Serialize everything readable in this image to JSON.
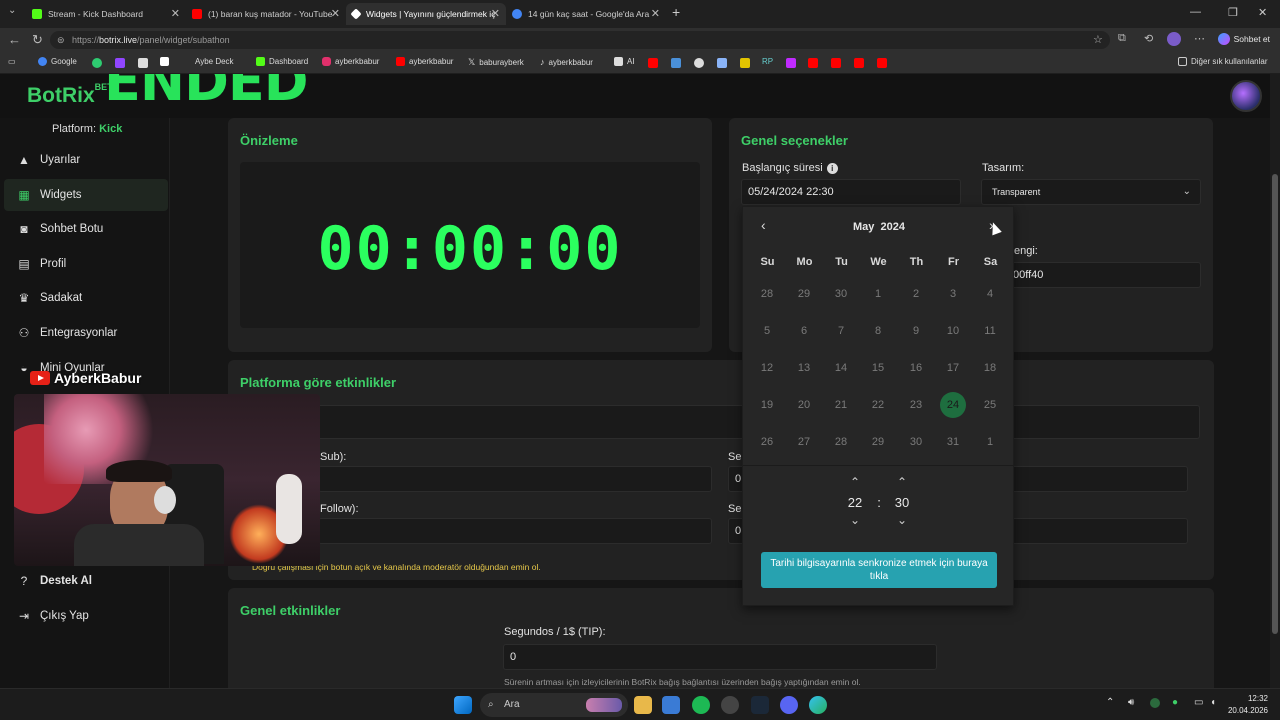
{
  "browser": {
    "tabs": [
      {
        "title": "Stream - Kick Dashboard",
        "color": "#53fc18"
      },
      {
        "title": "(1) baran kuş matador - YouTube",
        "color": "#ff0000"
      },
      {
        "title": "Widgets | Yayınını güçlendirmek iç",
        "color": "#ffffff"
      },
      {
        "title": "14 gün kaç saat - Google'da Ara",
        "color": "#4285f4"
      }
    ],
    "url_prefix": "https://",
    "url_host": "botrix.live",
    "url_path": "/panel/widget/subathon",
    "chat_button": "Sohbet et",
    "bookmarks": [
      "Google",
      "Aybe Deck",
      "Dashboard",
      "ayberkbabur",
      "ayberkbabur",
      "baburayberk",
      "ayberkbabur",
      "AI",
      "RP"
    ],
    "bookmarks_other": "Diğer sık kullanılanlar"
  },
  "app": {
    "logo": "BotRix",
    "logo_badge": "BETA",
    "overlay_text": "ENDED",
    "platform_label": "Platform:",
    "platform_value": "Kick",
    "nav": [
      {
        "label": "Uyarılar",
        "icon": "warning-icon"
      },
      {
        "label": "Widgets",
        "icon": "grid-icon"
      },
      {
        "label": "Sohbet Botu",
        "icon": "robot-icon"
      },
      {
        "label": "Profil",
        "icon": "id-card-icon"
      },
      {
        "label": "Sadakat",
        "icon": "trophy-icon"
      },
      {
        "label": "Entegrasyonlar",
        "icon": "plug-icon"
      },
      {
        "label": "Mini Oyunlar",
        "icon": "gamepad-icon"
      }
    ],
    "nav_bottom": [
      {
        "label": "Destek Al",
        "icon": "help-icon"
      },
      {
        "label": "Çıkış Yap",
        "icon": "logout-icon"
      }
    ]
  },
  "preview": {
    "title": "Önizleme",
    "timer": "00:00:00"
  },
  "general_options": {
    "title": "Genel seçenekler",
    "start_label": "Başlangıç süresi",
    "start_value": "05/24/2024 22:30",
    "design_label": "Tasarım:",
    "design_value": "Transparent",
    "color_label_fragment": "engi:",
    "color_value_fragment": "00ff40"
  },
  "calendar": {
    "month": "May",
    "year": "2024",
    "weekdays": [
      "Su",
      "Mo",
      "Tu",
      "We",
      "Th",
      "Fr",
      "Sa"
    ],
    "weeks": [
      [
        "28",
        "29",
        "30",
        "1",
        "2",
        "3",
        "4"
      ],
      [
        "5",
        "6",
        "7",
        "8",
        "9",
        "10",
        "11"
      ],
      [
        "12",
        "13",
        "14",
        "15",
        "16",
        "17",
        "18"
      ],
      [
        "19",
        "20",
        "21",
        "22",
        "23",
        "24",
        "25"
      ],
      [
        "26",
        "27",
        "28",
        "29",
        "30",
        "31",
        "1"
      ]
    ],
    "selected_day": "24",
    "hour": "22",
    "minute": "30",
    "separator": ":",
    "sync_button": "Tarihi bilgisayarınla senkronize etmek için buraya tıkla"
  },
  "platform_events": {
    "title": "Platforma göre etkinlikler",
    "sub_label_fragment": "Sub):",
    "follow_label_fragment": "Follow):",
    "right_label_fragment_1": "Se",
    "right_label_fragment_2": "Se",
    "right_value_1": "0",
    "right_value_2": "0",
    "warning": "Doğru çalışması için botun açık ve kanalında moderatör olduğundan emin ol."
  },
  "general_events": {
    "title": "Genel etkinlikler",
    "tip_label": "Segundos / 1$ (TIP):",
    "tip_value": "0",
    "tip_note": "Sürenin artması için izleyicilerinin BotRix bağış bağlantısı üzerinden bağış yaptığından emin ol."
  },
  "webcam": {
    "channel_name": "AyberkBabur"
  },
  "taskbar": {
    "search_placeholder": "Ara",
    "time": "12:32",
    "date": "20.04.2026"
  }
}
